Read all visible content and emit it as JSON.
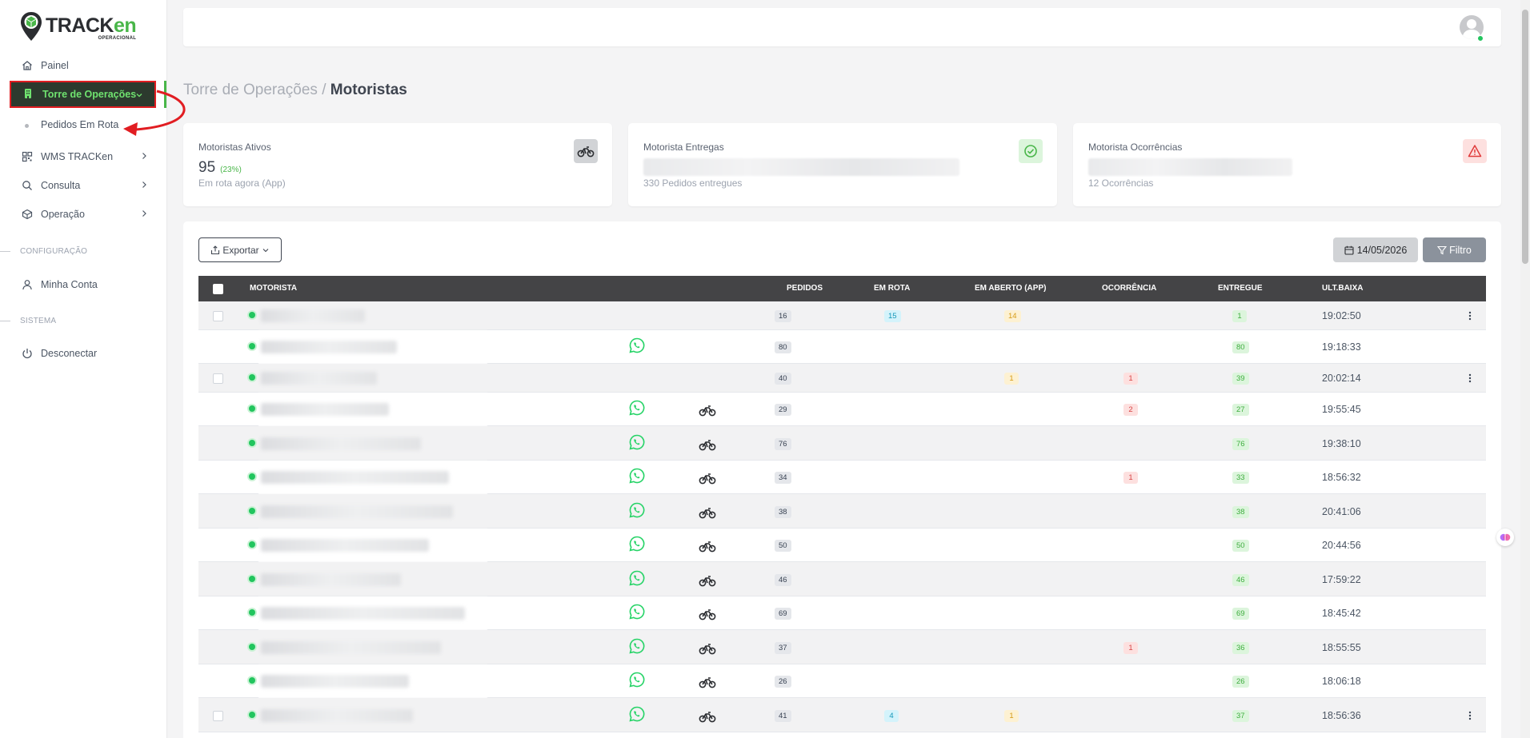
{
  "brand": {
    "name_main": "TRACK",
    "name_accent": "en",
    "tagline": "OPERACIONAL"
  },
  "sidebar": {
    "items": [
      {
        "label": "Painel",
        "icon": "home-icon"
      },
      {
        "label": "Torre de Operações",
        "icon": "building-icon",
        "active": true
      },
      {
        "label": "Pedidos Em Rota",
        "sub": true
      },
      {
        "label": "WMS TRACKen",
        "icon": "grid-icon"
      },
      {
        "label": "Consulta",
        "icon": "search-icon"
      },
      {
        "label": "Operação",
        "icon": "box-icon"
      }
    ],
    "section_config": "CONFIGURAÇÃO",
    "account": "Minha Conta",
    "section_system": "SISTEMA",
    "logout": "Desconectar"
  },
  "breadcrumb": {
    "parent": "Torre de Operações",
    "sep": " / ",
    "current": "Motoristas"
  },
  "cards": [
    {
      "title": "Motoristas Ativos",
      "value": "95",
      "pct": "(23%)",
      "sub": "Em rota agora (App)",
      "icon": "motorbike-icon"
    },
    {
      "title": "Motorista Entregas",
      "sub": "330 Pedidos entregues",
      "icon": "check-circle-icon"
    },
    {
      "title": "Motorista Ocorrências",
      "sub": "12 Ocorrências",
      "icon": "warning-icon"
    }
  ],
  "toolbar": {
    "export": "Exportar",
    "date": "14/05/2026",
    "filter": "Filtro"
  },
  "table": {
    "headers": {
      "motorista": "MOTORISTA",
      "pedidos": "PEDIDOS",
      "em_rota": "EM ROTA",
      "em_aberto": "EM ABERTO (APP)",
      "ocorrencia": "OCORRÊNCIA",
      "entregue": "ENTREGUE",
      "ult_baixa": "ULT.BAIXA"
    },
    "rows": [
      {
        "pedidos": "16",
        "em_rota": "15",
        "em_aberto": "14",
        "ocorrencia": "",
        "entregue": "1",
        "time": "19:02:50",
        "check": true,
        "wa": false,
        "bike": false,
        "menu": true,
        "alt": true
      },
      {
        "pedidos": "80",
        "em_rota": "",
        "em_aberto": "",
        "ocorrencia": "",
        "entregue": "80",
        "time": "19:18:33",
        "check": false,
        "wa": true,
        "bike": false,
        "menu": false,
        "alt": false
      },
      {
        "pedidos": "40",
        "em_rota": "",
        "em_aberto": "1",
        "ocorrencia": "1",
        "entregue": "39",
        "time": "20:02:14",
        "check": true,
        "wa": false,
        "bike": false,
        "menu": true,
        "alt": true
      },
      {
        "pedidos": "29",
        "em_rota": "",
        "em_aberto": "",
        "ocorrencia": "2",
        "entregue": "27",
        "time": "19:55:45",
        "check": false,
        "wa": true,
        "bike": true,
        "menu": false,
        "alt": false
      },
      {
        "pedidos": "76",
        "em_rota": "",
        "em_aberto": "",
        "ocorrencia": "",
        "entregue": "76",
        "time": "19:38:10",
        "check": false,
        "wa": true,
        "bike": true,
        "menu": false,
        "alt": true
      },
      {
        "pedidos": "34",
        "em_rota": "",
        "em_aberto": "",
        "ocorrencia": "1",
        "entregue": "33",
        "time": "18:56:32",
        "check": false,
        "wa": true,
        "bike": true,
        "menu": false,
        "alt": false
      },
      {
        "pedidos": "38",
        "em_rota": "",
        "em_aberto": "",
        "ocorrencia": "",
        "entregue": "38",
        "time": "20:41:06",
        "check": false,
        "wa": true,
        "bike": true,
        "menu": false,
        "alt": true
      },
      {
        "pedidos": "50",
        "em_rota": "",
        "em_aberto": "",
        "ocorrencia": "",
        "entregue": "50",
        "time": "20:44:56",
        "check": false,
        "wa": true,
        "bike": true,
        "menu": false,
        "alt": false
      },
      {
        "pedidos": "46",
        "em_rota": "",
        "em_aberto": "",
        "ocorrencia": "",
        "entregue": "46",
        "time": "17:59:22",
        "check": false,
        "wa": true,
        "bike": true,
        "menu": false,
        "alt": true
      },
      {
        "pedidos": "69",
        "em_rota": "",
        "em_aberto": "",
        "ocorrencia": "",
        "entregue": "69",
        "time": "18:45:42",
        "check": false,
        "wa": true,
        "bike": true,
        "menu": false,
        "alt": false
      },
      {
        "pedidos": "37",
        "em_rota": "",
        "em_aberto": "",
        "ocorrencia": "1",
        "entregue": "36",
        "time": "18:55:55",
        "check": false,
        "wa": true,
        "bike": true,
        "menu": false,
        "alt": true
      },
      {
        "pedidos": "26",
        "em_rota": "",
        "em_aberto": "",
        "ocorrencia": "",
        "entregue": "26",
        "time": "18:06:18",
        "check": false,
        "wa": true,
        "bike": true,
        "menu": false,
        "alt": false
      },
      {
        "pedidos": "41",
        "em_rota": "4",
        "em_aberto": "1",
        "ocorrencia": "",
        "entregue": "37",
        "time": "18:56:36",
        "check": true,
        "wa": true,
        "bike": true,
        "menu": true,
        "alt": true
      }
    ]
  },
  "colors": {
    "accent": "#49b649",
    "active_bg": "#2c3a2e",
    "annotation": "#e11d22",
    "header_bg": "#444446"
  }
}
